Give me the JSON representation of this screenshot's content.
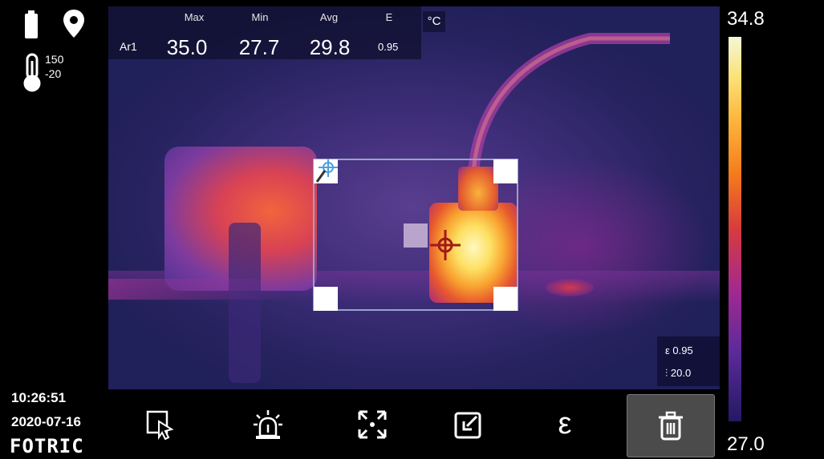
{
  "status": {
    "battery_icon": "battery-icon",
    "location_icon": "location-pin-icon",
    "range_icon": "thermometer-icon",
    "range_high": "150",
    "range_low": "-20"
  },
  "measurement": {
    "region_label": "Ar1",
    "headers": {
      "max": "Max",
      "min": "Min",
      "avg": "Avg",
      "e": "E"
    },
    "values": {
      "max": "35.0",
      "min": "27.7",
      "avg": "29.8",
      "e": "0.95"
    },
    "unit": "°C"
  },
  "scale": {
    "top": "34.8",
    "bottom": "27.0"
  },
  "params": {
    "emissivity_symbol": "ε",
    "emissivity": "0.95",
    "distance_symbol": "⫶",
    "reflected_temp": "20.0"
  },
  "footer": {
    "time": "10:26:51",
    "date": "2020-07-16",
    "brand": "FOTRIC"
  },
  "toolbar": {
    "buttons": [
      {
        "icon": "select-cursor-icon"
      },
      {
        "icon": "alarm-icon"
      },
      {
        "icon": "fullscreen-icon"
      },
      {
        "icon": "export-icon"
      },
      {
        "icon": "emissivity-icon",
        "label": "ε"
      },
      {
        "icon": "trash-icon",
        "active": true
      }
    ]
  },
  "colors": {
    "accent": "#fbe37a",
    "roi_border": "#9aa2c8",
    "marker": "#b9a4cc"
  }
}
